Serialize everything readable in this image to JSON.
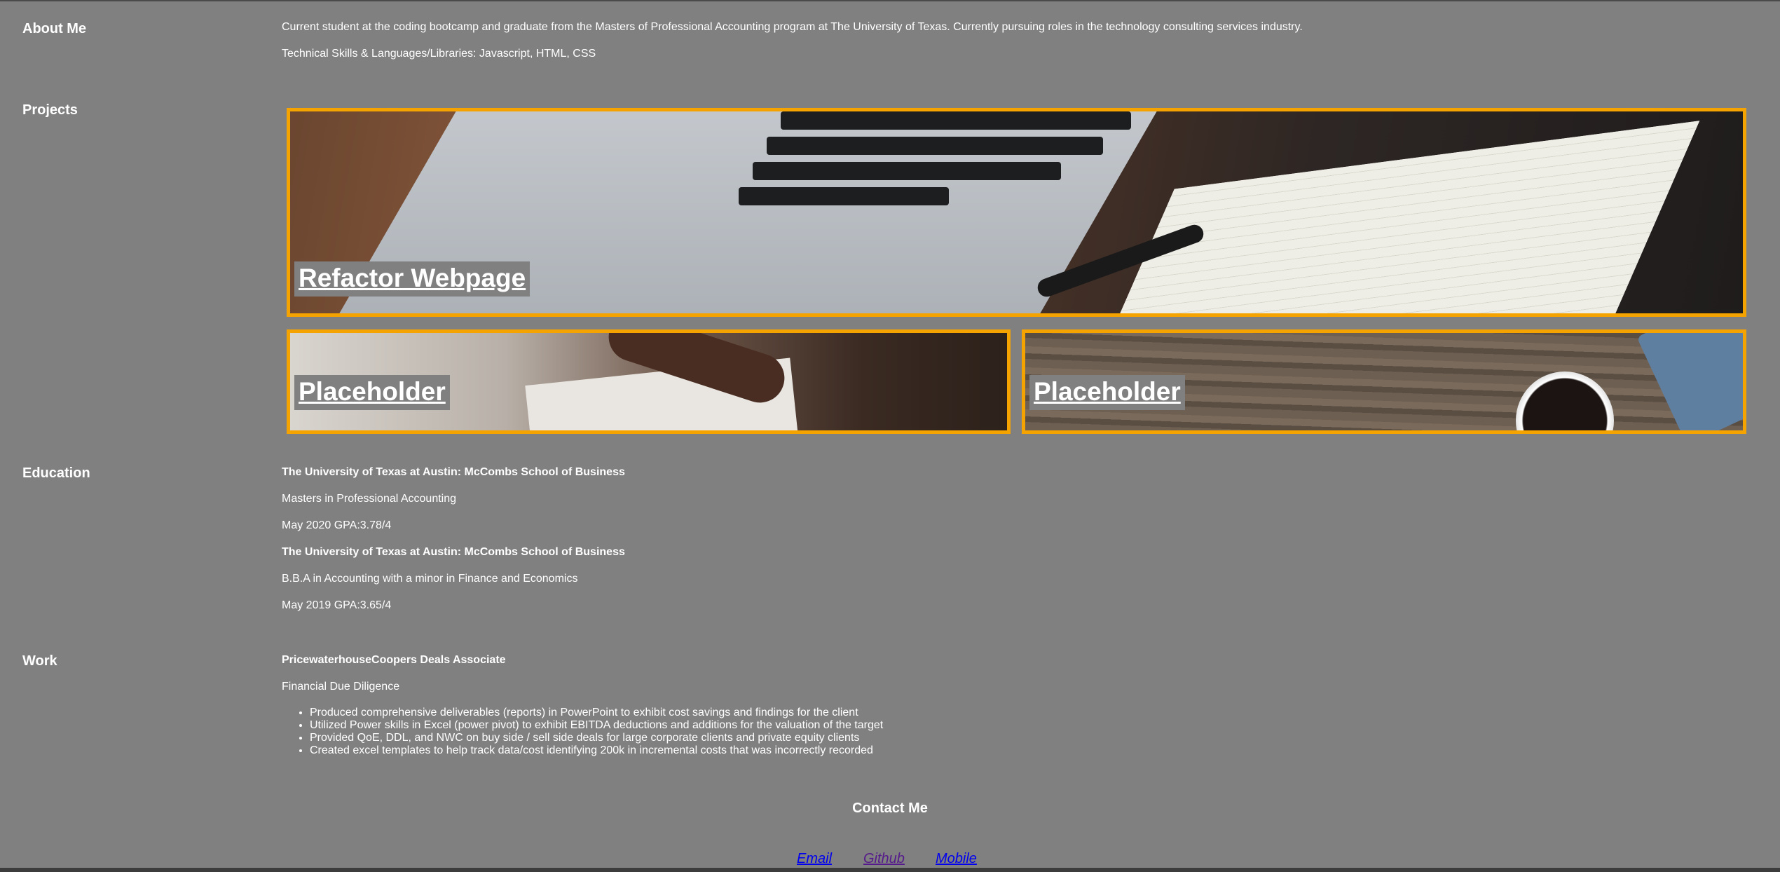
{
  "about": {
    "label": "About Me",
    "bio": "Current student at the coding bootcamp and graduate from the Masters of Professional Accounting program at The University of Texas. Currently pursuing roles in the technology consulting services industry.",
    "skills": "Technical Skills & Languages/Libraries: Javascript, HTML, CSS"
  },
  "projects": {
    "label": "Projects",
    "items": [
      {
        "title": "Refactor Webpage"
      },
      {
        "title": "Placeholder"
      },
      {
        "title": "Placeholder"
      }
    ],
    "accent_color": "#f5a300"
  },
  "education": {
    "label": "Education",
    "entries": [
      {
        "school": "The University of Texas at Austin: McCombs School of Business",
        "degree": "Masters in Professional Accounting",
        "date_gpa": "May 2020 GPA:3.78/4"
      },
      {
        "school": "The University of Texas at Austin: McCombs School of Business",
        "degree": "B.B.A in Accounting with a minor in Finance and Economics",
        "date_gpa": "May 2019 GPA:3.65/4"
      }
    ]
  },
  "work": {
    "label": "Work",
    "title": "PricewaterhouseCoopers Deals Associate",
    "subtitle": "Financial Due Diligence",
    "bullets": [
      "Produced comprehensive deliverables (reports) in PowerPoint to exhibit cost savings and findings for the client",
      "Utilized Power skills in Excel (power pivot) to exhibit EBITDA deductions and additions for the valuation of the target",
      "Provided QoE, DDL, and NWC on buy side / sell side deals for large corporate clients and private equity clients",
      "Created excel templates to help track data/cost identifying 200k in incremental costs that was incorrectly recorded"
    ]
  },
  "contact": {
    "title": "Contact Me",
    "links": {
      "email": "Email",
      "github": "Github",
      "mobile": "Mobile"
    }
  },
  "colors": {
    "background": "#808080",
    "text": "#ffffff",
    "link": "#0000ee",
    "visited_link": "#551a8b"
  }
}
